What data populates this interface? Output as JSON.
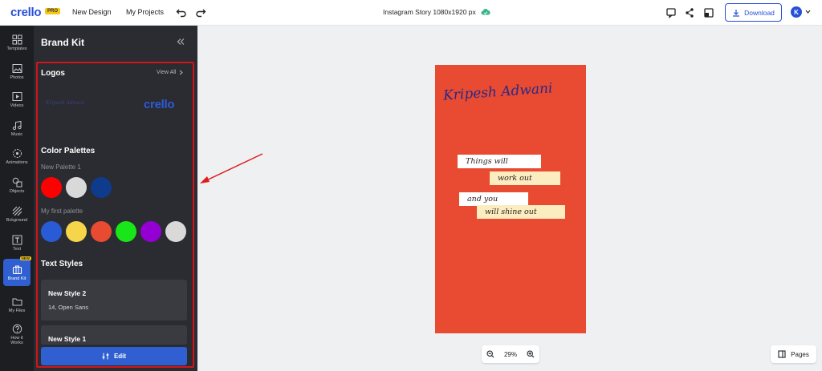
{
  "topbar": {
    "logo": "crello",
    "pro_badge": "PRO",
    "new_design": "New Design",
    "my_projects": "My Projects",
    "document_title": "Instagram Story 1080x1920 px",
    "download_label": "Download",
    "avatar_initial": "K"
  },
  "rail": {
    "items": [
      {
        "label": "Templates",
        "icon": "templates-icon"
      },
      {
        "label": "Photos",
        "icon": "photos-icon"
      },
      {
        "label": "Videos",
        "icon": "videos-icon"
      },
      {
        "label": "Music",
        "icon": "music-icon"
      },
      {
        "label": "Animations",
        "icon": "animations-icon"
      },
      {
        "label": "Objects",
        "icon": "objects-icon"
      },
      {
        "label": "Bckground",
        "icon": "background-icon"
      },
      {
        "label": "Text",
        "icon": "text-icon"
      },
      {
        "label": "Brand Kit",
        "icon": "brand-kit-icon"
      },
      {
        "label": "My Files",
        "icon": "folder-icon"
      },
      {
        "label": "How it Works",
        "icon": "help-icon"
      }
    ],
    "new_badge": "NEW"
  },
  "panel": {
    "title": "Brand Kit",
    "logos_title": "Logos",
    "view_all": "View All",
    "logo_signature_text": "Kripesh Adwani",
    "logo_wordmark": "crello",
    "color_palettes_title": "Color Palettes",
    "palettes": [
      {
        "name": "New Palette 1",
        "colors": [
          "#ff0000",
          "#d9d9d9",
          "#0e3b8c"
        ]
      },
      {
        "name": "My first palette",
        "colors": [
          "#2a5bd7",
          "#f7d54a",
          "#e84a32",
          "#19e619",
          "#9400d3",
          "#d9d9d9"
        ]
      }
    ],
    "text_styles_title": "Text Styles",
    "text_styles": [
      {
        "name": "New Style 2",
        "meta": "14, Open Sans"
      },
      {
        "name": "New Style 1",
        "meta": ""
      }
    ],
    "edit_label": "Edit"
  },
  "canvas": {
    "signature": "Kripesh Adwani",
    "lines": [
      "Things will",
      "work out",
      "and you",
      "will shine out"
    ],
    "background_color": "#e84a32",
    "zoom": "29%",
    "pages_label": "Pages"
  },
  "colors": {
    "accent": "#2750d8",
    "highlight": "#d0151b",
    "panel_bg": "#2b2c31",
    "rail_bg": "#1d1e22"
  }
}
